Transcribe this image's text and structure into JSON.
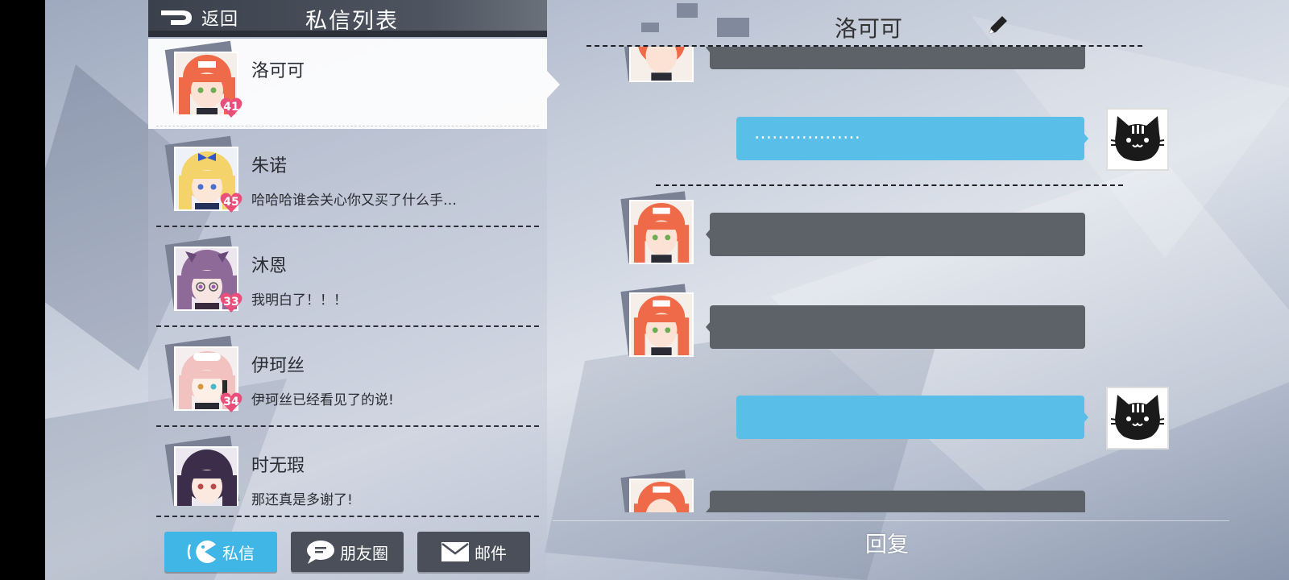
{
  "header": {
    "back_label": "返回",
    "title": "私信列表"
  },
  "contacts": [
    {
      "name": "洛可可",
      "message": "",
      "level": "41",
      "active": true,
      "hair": "#ee6a48",
      "eye": "#6cae52"
    },
    {
      "name": "朱诺",
      "message": "哈哈哈谁会关心你又买了什么手…",
      "level": "45",
      "active": false,
      "hair": "#f4d46a",
      "eye": "#4a6fcf"
    },
    {
      "name": "沐恩",
      "message": "我明白了！！！",
      "level": "33",
      "active": false,
      "hair": "#8e6a98",
      "eye": "#9c5ab0"
    },
    {
      "name": "伊珂丝",
      "message": "伊珂丝已经看见了的说!",
      "level": "34",
      "active": false,
      "hair": "#f2c2c0",
      "eye": "#d49a3c"
    },
    {
      "name": "时无瑕",
      "message": "那还真是多谢了!",
      "level": "",
      "active": false,
      "hair": "#3c2e4a",
      "eye": "#b84a4a"
    }
  ],
  "tabs": [
    {
      "label": "私信",
      "active": true
    },
    {
      "label": "朋友圈",
      "active": false
    },
    {
      "label": "邮件",
      "active": false
    }
  ],
  "chat": {
    "title": "洛可可",
    "reply_label": "回复",
    "my_message_1": "………………"
  },
  "colors": {
    "accent_blue": "#3fb6e6",
    "bubble_dark": "#5d6168",
    "bubble_blue": "#59bfe8",
    "level_pink": "#e94f7a"
  },
  "icons": {
    "back": "back-arrow-icon",
    "edit": "pencil-icon",
    "cat": "cat-avatar-icon",
    "chat_tab": "pacman-chat-icon",
    "moments_tab": "speech-bubble-icon",
    "mail_tab": "envelope-icon"
  }
}
